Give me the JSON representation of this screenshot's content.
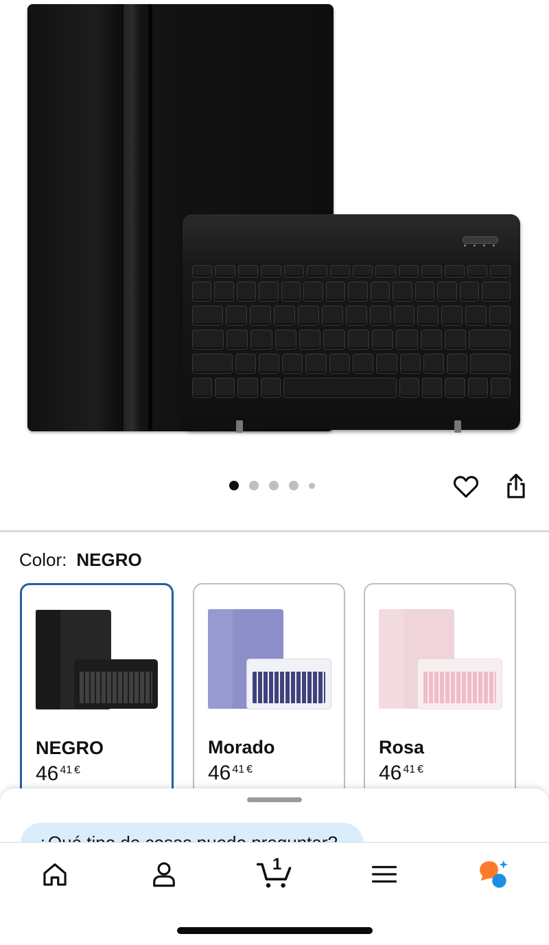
{
  "gallery": {
    "image_alt": "Funda con teclado negro",
    "dots_total": 5,
    "active_index": 0,
    "icons": {
      "favorite": "heart-outline-icon",
      "share": "share-icon"
    }
  },
  "color_selector": {
    "label": "Color:",
    "selected_value": "NEGRO",
    "options": [
      {
        "name": "NEGRO",
        "price_whole": "46",
        "price_fraction": "41",
        "currency": "€",
        "selected": true,
        "tablet_color": "#2a2a2a",
        "keyboard_color": "#1c1c1c",
        "key_color": "#3a3a3a"
      },
      {
        "name": "Morado",
        "price_whole": "46",
        "price_fraction": "41",
        "currency": "€",
        "selected": false,
        "tablet_color": "#8c8fc9",
        "keyboard_color": "#f1f2f7",
        "key_color": "#2d2f6e"
      },
      {
        "name": "Rosa",
        "price_whole": "46",
        "price_fraction": "41",
        "currency": "€",
        "selected": false,
        "tablet_color": "#efd4da",
        "keyboard_color": "#f7eef0",
        "key_color": "#f0b7c3"
      }
    ]
  },
  "assistant_sheet": {
    "question_chip": "¿Qué tipo de cosas puedo preguntar?"
  },
  "tab_bar": {
    "cart_count": "1",
    "tabs": [
      {
        "name": "home",
        "icon": "home-icon"
      },
      {
        "name": "account",
        "icon": "user-icon"
      },
      {
        "name": "cart",
        "icon": "cart-icon"
      },
      {
        "name": "menu",
        "icon": "menu-icon"
      },
      {
        "name": "rufus",
        "icon": "rufus-assistant-icon"
      }
    ]
  },
  "colors": {
    "selected_border": "#2162a1",
    "chip_background": "#d9eefb",
    "rufus_orange": "#ff7b2c",
    "rufus_blue": "#1a8fe3"
  }
}
